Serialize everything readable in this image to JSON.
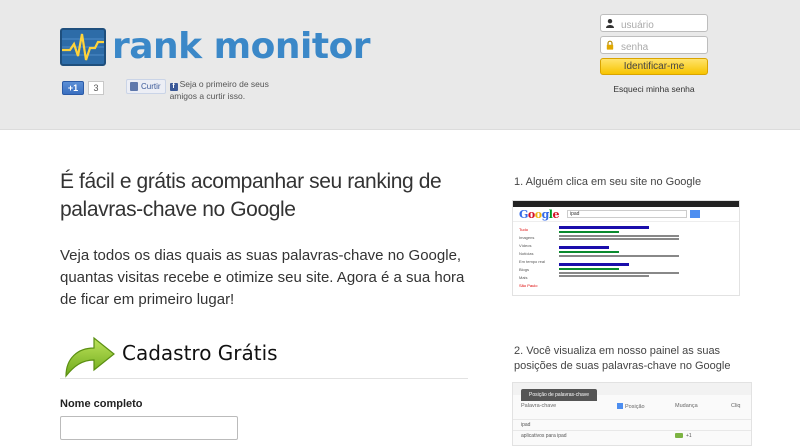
{
  "header": {
    "logo_text": "rank monitor",
    "gplus": {
      "label": "+1",
      "count": "3"
    },
    "facebook": {
      "button_label": "Curtir",
      "text": "Seja o primeiro de seus amigos a curtir isso."
    },
    "login": {
      "username_placeholder": "usuário",
      "password_placeholder": "senha",
      "submit_label": "Identificar-me",
      "forgot_label": "Esqueci minha senha"
    }
  },
  "main": {
    "headline": "É fácil e grátis acompanhar seu ranking de palavras-chave no Google",
    "lead": "Veja todos os dias quais as suas palavras-chave no Google, quantas visitas recebe e otimize seu site. Agora é a sua hora de ficar em primeiro lugar!",
    "signup_label": "Cadastro Grátis",
    "form": {
      "name_label": "Nome completo",
      "name_value": ""
    }
  },
  "steps": {
    "step1": "1. Alguém clica em seu site no Google",
    "step2": "2. Você visualiza em nosso painel as suas posições de suas palavras-chave no Google",
    "search_shot": {
      "query": "ipad",
      "sidebar": [
        "Tudo",
        "Imagens",
        "Vídeos",
        "Notícias",
        "Em tempo real",
        "Blogs",
        "Mais",
        "São Paulo"
      ]
    },
    "panel_shot": {
      "tab": "Posição de palavras-chave",
      "columns": [
        "Palavra-chave",
        "Posição",
        "Mudança",
        "Cliq"
      ],
      "rows": [
        {
          "keyword": "ipad",
          "position": "",
          "change": ""
        },
        {
          "keyword": "aplicativos para ipad",
          "position": "",
          "change": "+1"
        }
      ]
    }
  },
  "colors": {
    "brand_blue": "#3b88c8",
    "login_yellow": "#f7c400",
    "header_bg": "#e9e9e9"
  }
}
